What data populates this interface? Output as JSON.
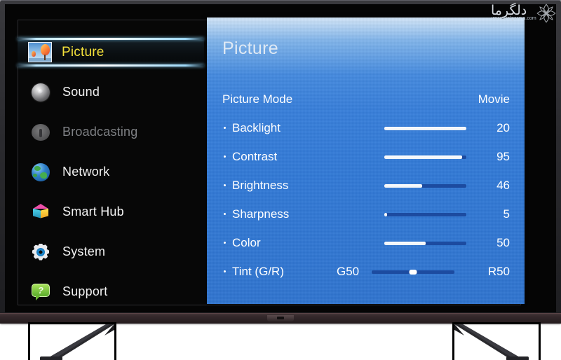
{
  "device": {
    "type": "television",
    "brand_badge": "",
    "screen_background": "#050505"
  },
  "sidebar": {
    "items": [
      {
        "label": "Picture",
        "icon": "balloon-photo-icon",
        "state": "selected"
      },
      {
        "label": "Sound",
        "icon": "speaker-icon",
        "state": "normal"
      },
      {
        "label": "Broadcasting",
        "icon": "satellite-dish-icon",
        "state": "disabled"
      },
      {
        "label": "Network",
        "icon": "globe-icon",
        "state": "normal"
      },
      {
        "label": "Smart Hub",
        "icon": "cube-icon",
        "state": "normal"
      },
      {
        "label": "System",
        "icon": "gear-icon",
        "state": "normal"
      },
      {
        "label": "Support",
        "icon": "question-bubble-icon",
        "state": "normal"
      }
    ],
    "selected_text_color": "#f3e03a",
    "disabled_text_color": "#7e8084"
  },
  "panel": {
    "title": "Picture",
    "accent_color": "#3179d6",
    "rows": [
      {
        "label": "Picture Mode",
        "value": "Movie",
        "has_slider": false,
        "indent": false
      },
      {
        "label": "Backlight",
        "value": "20",
        "has_slider": true,
        "indent": true,
        "fill_percent": 100
      },
      {
        "label": "Contrast",
        "value": "95",
        "has_slider": true,
        "indent": true,
        "fill_percent": 95
      },
      {
        "label": "Brightness",
        "value": "46",
        "has_slider": true,
        "indent": true,
        "fill_percent": 46
      },
      {
        "label": "Sharpness",
        "value": "5",
        "has_slider": true,
        "indent": true,
        "fill_percent": 3
      },
      {
        "label": "Color",
        "value": "50",
        "has_slider": true,
        "indent": true,
        "fill_percent": 50
      },
      {
        "label": "Tint (G/R)",
        "value": "R50",
        "min_label": "G50",
        "has_slider": true,
        "is_tint": true,
        "indent": true,
        "thumb_percent": 50
      }
    ]
  },
  "watermark": {
    "brand": "دلگرما",
    "url": "www.Delgarma.com"
  }
}
